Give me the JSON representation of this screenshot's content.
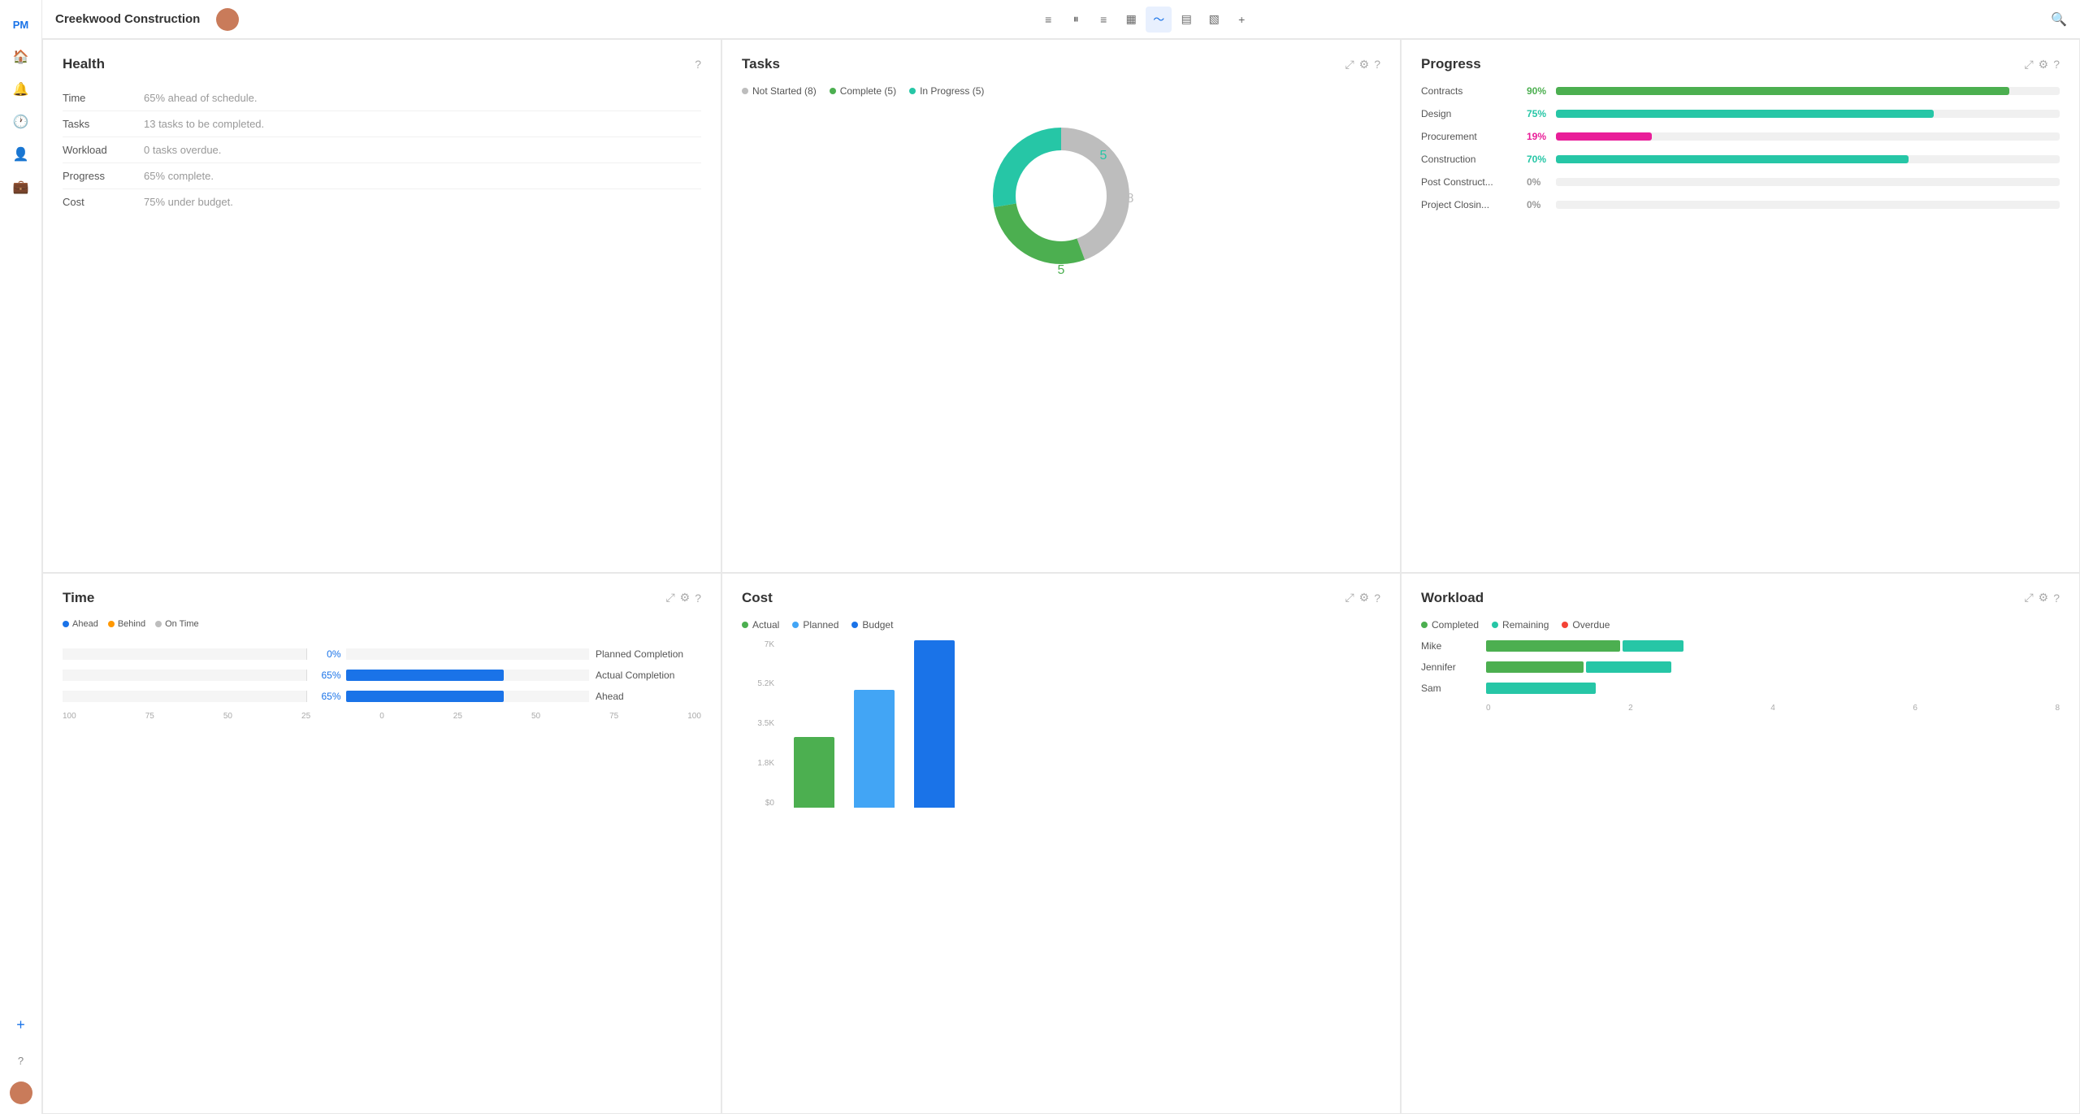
{
  "app": {
    "name": "PM Tool",
    "project": "Creekwood Construction"
  },
  "topbar": {
    "icons": [
      {
        "name": "list-icon",
        "symbol": "≡",
        "active": false
      },
      {
        "name": "columns-icon",
        "symbol": "⏸",
        "active": false
      },
      {
        "name": "rows-icon",
        "symbol": "≡",
        "active": false
      },
      {
        "name": "table-icon",
        "symbol": "▦",
        "active": false
      },
      {
        "name": "chart-icon",
        "symbol": "∿",
        "active": true
      },
      {
        "name": "calendar-icon",
        "symbol": "▤",
        "active": false
      },
      {
        "name": "doc-icon",
        "symbol": "▧",
        "active": false
      },
      {
        "name": "add-icon",
        "symbol": "+",
        "active": false
      }
    ]
  },
  "health": {
    "title": "Health",
    "rows": [
      {
        "label": "Time",
        "value": "65% ahead of schedule."
      },
      {
        "label": "Tasks",
        "value": "13 tasks to be completed."
      },
      {
        "label": "Workload",
        "value": "0 tasks overdue."
      },
      {
        "label": "Progress",
        "value": "65% complete."
      },
      {
        "label": "Cost",
        "value": "75% under budget."
      }
    ]
  },
  "tasks": {
    "title": "Tasks",
    "legend": [
      {
        "label": "Not Started (8)",
        "color": "#bdbdbd"
      },
      {
        "label": "Complete (5)",
        "color": "#4caf50"
      },
      {
        "label": "In Progress (5)",
        "color": "#26c6a6"
      }
    ],
    "donut": {
      "not_started": 8,
      "complete": 5,
      "in_progress": 5,
      "label_top": "5",
      "label_bottom": "5"
    }
  },
  "progress": {
    "title": "Progress",
    "rows": [
      {
        "label": "Contracts",
        "pct": 90,
        "color": "#4caf50",
        "pct_label": "90%",
        "pct_color": "pct-green"
      },
      {
        "label": "Design",
        "pct": 75,
        "color": "#26c6a6",
        "pct_label": "75%",
        "pct_color": "pct-teal"
      },
      {
        "label": "Procurement",
        "pct": 19,
        "color": "#e91e99",
        "pct_label": "19%",
        "pct_color": "pct-pink"
      },
      {
        "label": "Construction",
        "pct": 70,
        "color": "#26c6a6",
        "pct_label": "70%",
        "pct_color": "pct-teal"
      },
      {
        "label": "Post Construct...",
        "pct": 0,
        "color": "#26c6a6",
        "pct_label": "0%",
        "pct_color": "pct-gray"
      },
      {
        "label": "Project Closin...",
        "pct": 0,
        "color": "#26c6a6",
        "pct_label": "0%",
        "pct_color": "pct-gray"
      }
    ]
  },
  "time": {
    "title": "Time",
    "legend": [
      {
        "label": "Ahead",
        "color": "#1a73e8"
      },
      {
        "label": "Behind",
        "color": "#ff9800"
      },
      {
        "label": "On Time",
        "color": "#bdbdbd"
      }
    ],
    "rows": [
      {
        "label": "Planned Completion",
        "pct_label": "0%",
        "pct": 0,
        "bar_side": "right",
        "color": "#1a73e8"
      },
      {
        "label": "Actual Completion",
        "pct_label": "65%",
        "pct": 65,
        "bar_side": "right",
        "color": "#1a73e8"
      },
      {
        "label": "Ahead",
        "pct_label": "65%",
        "pct": 65,
        "bar_side": "right",
        "color": "#1a73e8"
      }
    ],
    "axis": [
      "100",
      "75",
      "50",
      "25",
      "0",
      "25",
      "50",
      "75",
      "100"
    ]
  },
  "cost": {
    "title": "Cost",
    "legend": [
      {
        "label": "Actual",
        "color": "#4caf50"
      },
      {
        "label": "Planned",
        "color": "#42a5f5"
      },
      {
        "label": "Budget",
        "color": "#1a73e8"
      }
    ],
    "y_labels": [
      "7K",
      "5.2K",
      "3.5K",
      "1.8K",
      "$0"
    ],
    "bars": [
      {
        "actual": 45,
        "planned": 0,
        "budget": 0
      },
      {
        "actual": 0,
        "planned": 70,
        "budget": 0
      },
      {
        "actual": 0,
        "planned": 0,
        "budget": 100
      }
    ]
  },
  "workload": {
    "title": "Workload",
    "legend": [
      {
        "label": "Completed",
        "color": "#4caf50"
      },
      {
        "label": "Remaining",
        "color": "#26c6a6"
      },
      {
        "label": "Overdue",
        "color": "#f44336"
      }
    ],
    "rows": [
      {
        "label": "Mike",
        "completed": 55,
        "remaining": 25,
        "overdue": 0
      },
      {
        "label": "Jennifer",
        "completed": 40,
        "remaining": 35,
        "overdue": 0
      },
      {
        "label": "Sam",
        "completed": 0,
        "remaining": 45,
        "overdue": 0
      }
    ],
    "axis": [
      "0",
      "2",
      "4",
      "6",
      "8"
    ]
  },
  "labels": {
    "expand": "⤢",
    "settings": "⚙",
    "help": "?"
  }
}
